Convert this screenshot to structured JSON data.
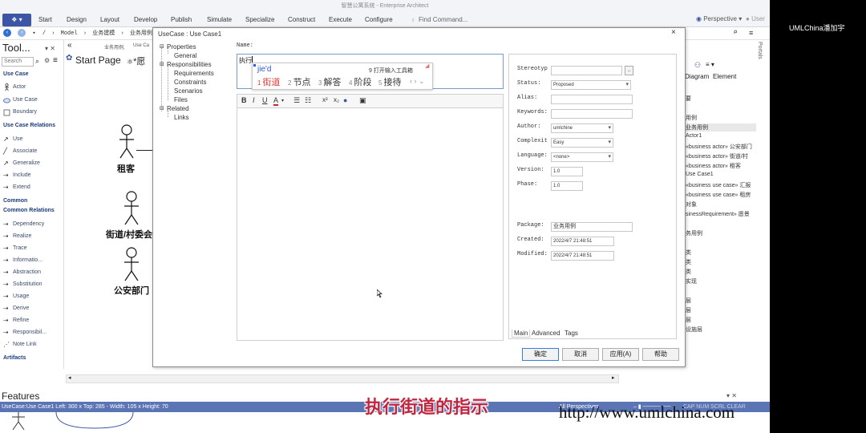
{
  "app": {
    "title": "智慧公寓系统 - Enterprise Architect",
    "menu_button": "❖ ▾",
    "ribbon_tabs": [
      "Start",
      "Design",
      "Layout",
      "Develop",
      "Publish",
      "Simulate",
      "Specialize",
      "Construct",
      "Execute",
      "Configure"
    ],
    "find_command": "Find Command...",
    "perspective": "Perspective",
    "user": "User"
  },
  "breadcrumb": {
    "sep": "/",
    "items": [
      "Model",
      "业务建模",
      "业务用例"
    ]
  },
  "toolbox": {
    "title": "Tool...",
    "search_placeholder": "Search",
    "sections": [
      {
        "name": "Use Case",
        "items": [
          "Actor",
          "Use Case",
          "Boundary"
        ]
      },
      {
        "name": "Use Case Relations",
        "items": [
          "Use",
          "Associate",
          "Generalize",
          "Include",
          "Extend"
        ]
      },
      {
        "name": "Common",
        "items": []
      },
      {
        "name": "Common Relations",
        "items": [
          "Dependency",
          "Realize",
          "Trace",
          "Informatio...",
          "Abstraction",
          "Substitution",
          "Usage",
          "Derive",
          "Refine",
          "Responsibil...",
          "Note Link"
        ]
      },
      {
        "name": "Artifacts",
        "items": []
      }
    ]
  },
  "diagram": {
    "tab_arrows": "«",
    "tab_path": "业务用例,",
    "tab_extra": "Use Ca",
    "start_page_tab": "Start Page",
    "diagram_tab": "*愿",
    "actors": [
      "租客",
      "街道/村委会",
      "公安部门"
    ]
  },
  "right_panel": {
    "tabs": [
      "Diagram",
      "Element"
    ],
    "items": [
      "要",
      "用例",
      "业务用例",
      "Actor1",
      "«business actor» 公安部门",
      "«business actor» 街道/村",
      "«business actor» 租客",
      "Use Case1",
      "«business use case» 汇报",
      "«business use case» 租房",
      "对象",
      "sinessRequirement» 愿景",
      "务用例",
      "类",
      "类",
      "类",
      "实现",
      "层",
      "层",
      "层",
      "设施层"
    ],
    "portals": "Portals"
  },
  "dialog": {
    "title": "UseCase : Use Case1",
    "close": "×",
    "tree": [
      {
        "label": "Properties",
        "level": 0
      },
      {
        "label": "General",
        "level": 1
      },
      {
        "label": "Responsibilities",
        "level": 0
      },
      {
        "label": "Requirements",
        "level": 1
      },
      {
        "label": "Constraints",
        "level": 1
      },
      {
        "label": "Scenarios",
        "level": 1
      },
      {
        "label": "Files",
        "level": 1
      },
      {
        "label": "Related",
        "level": 0
      },
      {
        "label": "Links",
        "level": 1
      }
    ],
    "name_label": "Name:",
    "name_value": "执行",
    "ime": {
      "pinyin": "jie'd",
      "toolbox_hint": "9 打开输入工具箱",
      "candidates": [
        {
          "num": "1",
          "text": "街道"
        },
        {
          "num": "2",
          "text": "节点"
        },
        {
          "num": "3",
          "text": "解答"
        },
        {
          "num": "4",
          "text": "阶段"
        },
        {
          "num": "5",
          "text": "接待"
        }
      ],
      "nav": "‹ › ⌄"
    },
    "notes_toolbar": [
      "B",
      "I",
      "U",
      "A",
      "☰",
      "☷",
      "x²",
      "x₂",
      "●",
      "▣"
    ],
    "props": {
      "stereotype_label": "Stereotyp",
      "stereotype_value": "",
      "status_label": "Status:",
      "status_value": "Proposed",
      "alias_label": "Alias:",
      "alias_value": "",
      "keywords_label": "Keywords:",
      "keywords_value": "",
      "author_label": "Author:",
      "author_value": "umlchine",
      "complexity_label": "Complexit",
      "complexity_value": "Easy",
      "language_label": "Language:",
      "language_value": "<none>",
      "version_label": "Version:",
      "version_value": "1.0",
      "phase_label": "Phase:",
      "phase_value": "1.0",
      "package_label": "Package:",
      "package_value": "业务用例",
      "created_label": "Created:",
      "created_value": "2022/4/7 21:48:51",
      "modified_label": "Modified:",
      "modified_value": "2022/4/7 21:48:51",
      "tabs": [
        "Main",
        "Advanced",
        "Tags"
      ]
    },
    "buttons": {
      "ok": "确定",
      "cancel": "取消",
      "apply": "应用(A)",
      "help": "帮助"
    }
  },
  "features_label": "Features",
  "status_bar": {
    "text": "UseCase:Use Case1   Left:   300 x Top:   285 - Width:   105 x Height:   70",
    "right": "All Perspectives",
    "modes": "CAP  NUM  SCRL  CLEAR"
  },
  "sidebar": {
    "user_name": "UMLChina潘加宇"
  },
  "subtitle": "执行街道的指示",
  "watermark": "http://www.umlchina.com",
  "colors": {
    "accent": "#3c55a5",
    "status_bar": "#5a74b4",
    "subtitle": "#c0263f",
    "ime_selected": "#e53935"
  }
}
